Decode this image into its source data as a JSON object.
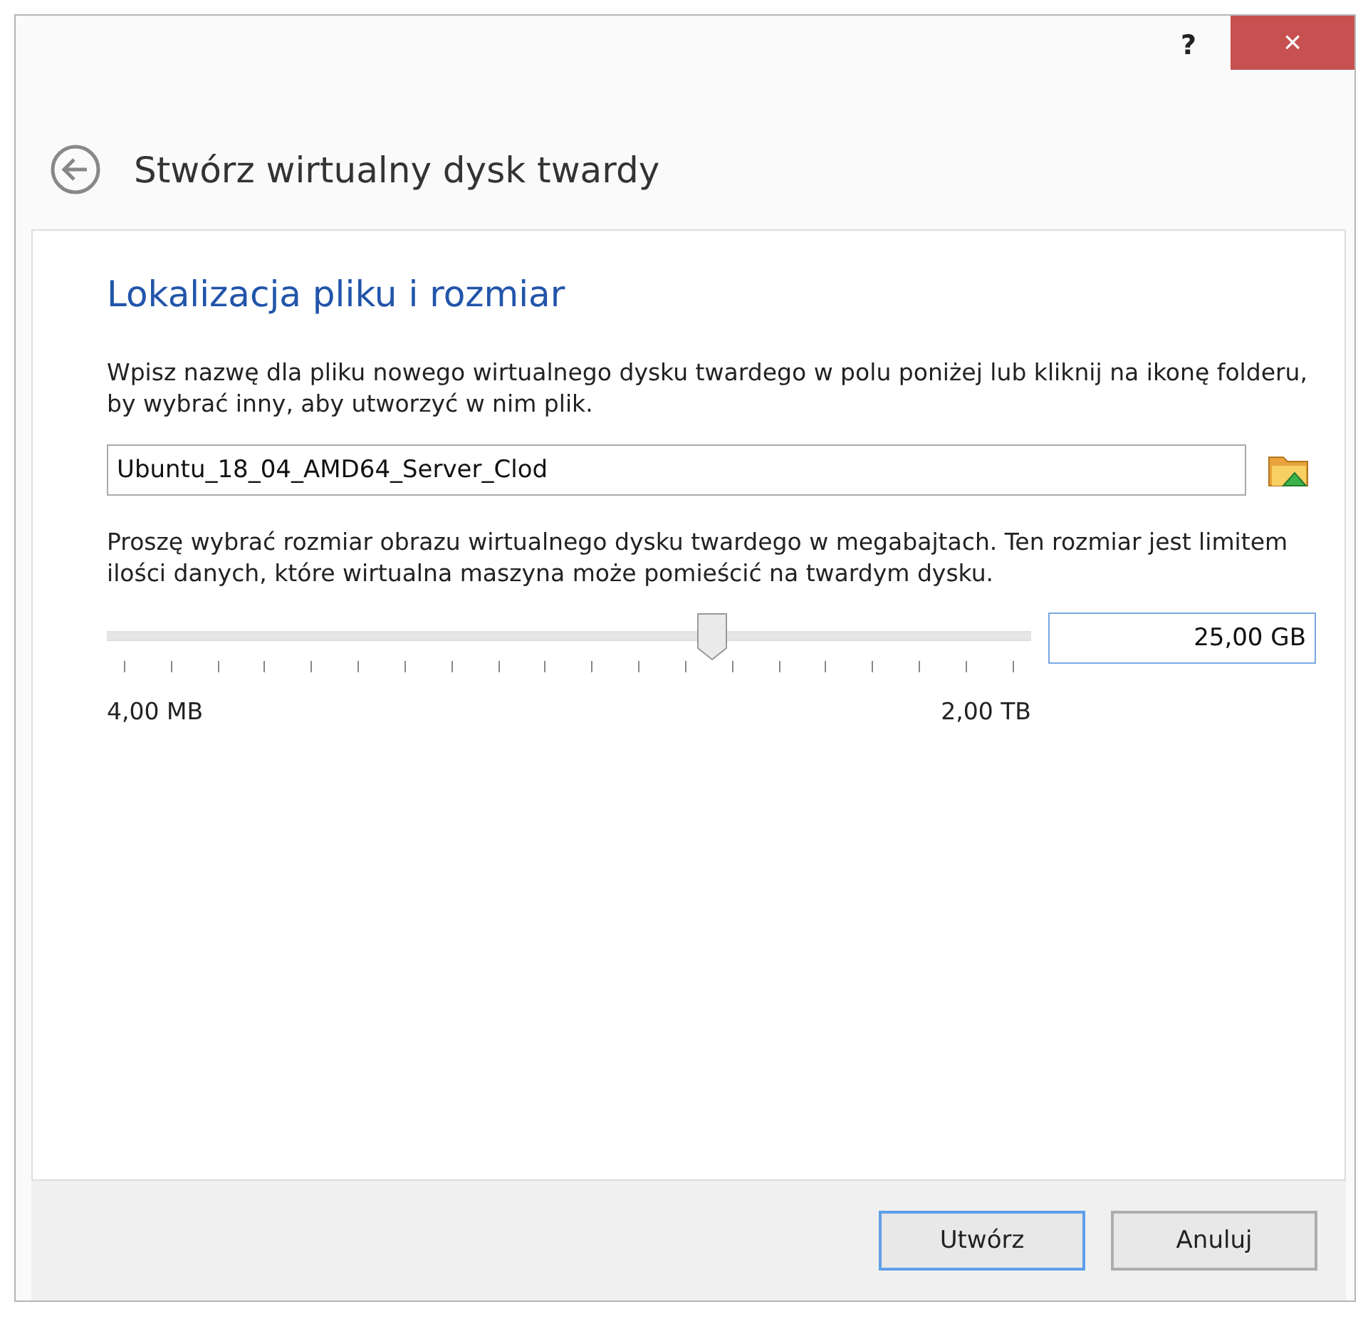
{
  "window": {
    "help": "?",
    "close": "×"
  },
  "header": {
    "title": "Stwórz wirtualny dysk twardy"
  },
  "page": {
    "heading": "Lokalizacja pliku i rozmiar",
    "file_description": "Wpisz nazwę dla pliku nowego wirtualnego dysku twardego w polu poniżej lub kliknij na ikonę folderu, by wybrać inny, aby utworzyć w nim plik.",
    "file_name": "Ubuntu_18_04_AMD64_Server_Clod",
    "size_description": "Proszę wybrać rozmiar obrazu wirtualnego dysku twardego w megabajtach. Ten rozmiar jest limitem ilości danych, które wirtualna maszyna może pomieścić na twardym dysku.",
    "size_slider": {
      "level": 0.655,
      "min_label": "4,00 MB",
      "max_label": "2,00 TB"
    },
    "size_value": "25,00 GB"
  },
  "buttons": [
    {
      "label": "Utwórz",
      "default": true
    },
    {
      "label": "Anuluj",
      "default": false
    }
  ]
}
